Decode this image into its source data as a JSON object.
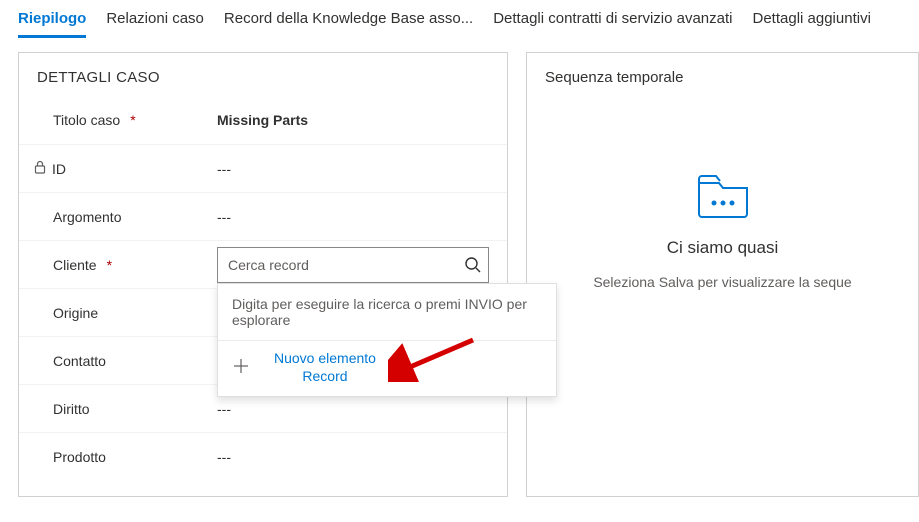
{
  "tabs": {
    "summary": "Riepilogo",
    "relations": "Relazioni caso",
    "kb": "Record della Knowledge Base asso...",
    "contracts": "Dettagli contratti di servizio avanzati",
    "additional": "Dettagli aggiuntivi"
  },
  "panel": {
    "case_details_title": "DETTAGLI CASO",
    "timeline_title": "Sequenza temporale"
  },
  "fields": {
    "title": {
      "label": "Titolo caso",
      "value": "Missing Parts"
    },
    "id": {
      "label": "ID",
      "value": "---"
    },
    "subject": {
      "label": "Argomento",
      "value": "---"
    },
    "customer": {
      "label": "Cliente",
      "placeholder": "Cerca record",
      "value": ""
    },
    "origin": {
      "label": "Origine",
      "value": ""
    },
    "contact": {
      "label": "Contatto",
      "value": ""
    },
    "entitlement": {
      "label": "Diritto",
      "value": "---"
    },
    "product": {
      "label": "Prodotto",
      "value": "---"
    }
  },
  "flyout": {
    "hint": "Digita per eseguire la ricerca o premi INVIO per esplorare",
    "new_record_line1": "Nuovo elemento",
    "new_record_line2": "Record"
  },
  "timeline_empty": {
    "title": "Ci siamo quasi",
    "subtitle": "Seleziona Salva per visualizzare la seque"
  },
  "colors": {
    "accent": "#0078d4",
    "required": "#a80000"
  }
}
